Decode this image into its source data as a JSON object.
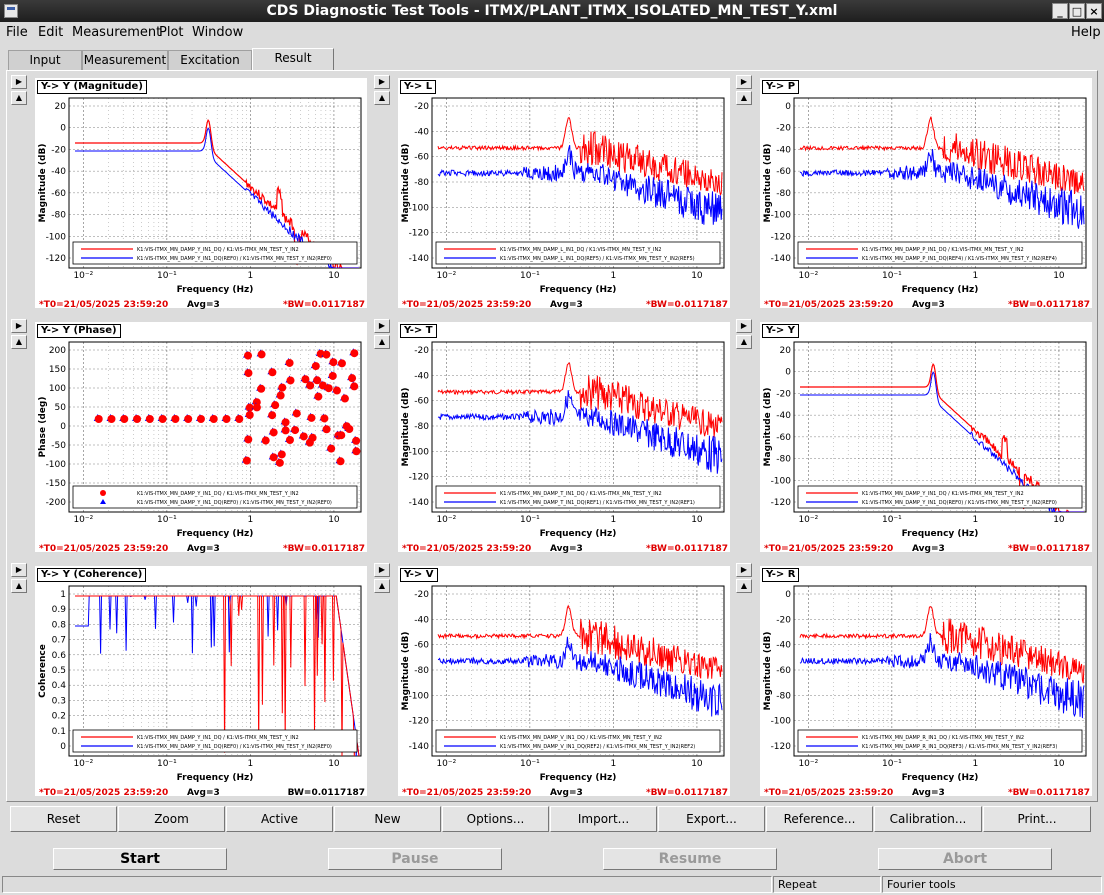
{
  "window": {
    "title": "CDS Diagnostic Test Tools - ITMX/PLANT_ITMX_ISOLATED_MN_TEST_Y.xml",
    "controls": [
      "_",
      "□",
      "×"
    ]
  },
  "menu": {
    "file": "File",
    "edit": "Edit",
    "measurement": "Measurement",
    "plot": "Plot",
    "window": "Window",
    "help": "Help"
  },
  "tabs": [
    "Input",
    "Measurement",
    "Excitation",
    "Result"
  ],
  "colors": {
    "red": "#ff0000",
    "blue": "#0000ff"
  },
  "panels": [
    {
      "title": "Y-> Y (Magnitude)",
      "ylabel": "Magnitude (dB)",
      "xlabel": "Frequency (Hz)",
      "yticks": [
        "20",
        "0",
        "-20",
        "-40",
        "-60",
        "-80",
        "-100",
        "-120"
      ],
      "xticks": [
        "10⁻²",
        "10⁻¹",
        "1",
        "10"
      ],
      "legend": [
        "K1:VIS-ITMX_MN_DAMP_Y_IN1_DQ / K1:VIS-ITMX_MN_TEST_Y_IN2",
        "K1:VIS-ITMX_MN_DAMP_Y_IN1_DQ(REF0) / K1:VIS-ITMX_MN_TEST_Y_IN2(REF0)"
      ],
      "t0": "*T0=21/05/2025 23:59:20",
      "avg": "Avg=3",
      "bw": "*BW=0.0117187",
      "kind": "mag"
    },
    {
      "title": "Y-> L",
      "ylabel": "Magnitude (dB)",
      "xlabel": "Frequency (Hz)",
      "yticks": [
        "-20",
        "-40",
        "-60",
        "-80",
        "-100",
        "-120",
        "-140"
      ],
      "xticks": [
        "10⁻²",
        "10⁻¹",
        "1",
        "10"
      ],
      "legend": [
        "K1:VIS-ITMX_MN_DAMP_L_IN1_DQ / K1:VIS-ITMX_MN_TEST_Y_IN2",
        "K1:VIS-ITMX_MN_DAMP_L_IN1_DQ(REF5) / K1:VIS-ITMX_MN_TEST_Y_IN2(REF5)"
      ],
      "t0": "*T0=21/05/2025 23:59:20",
      "avg": "Avg=3",
      "bw": "*BW=0.0117187",
      "kind": "cross"
    },
    {
      "title": "Y-> P",
      "ylabel": "Magnitude (dB)",
      "xlabel": "Frequency (Hz)",
      "yticks": [
        "0",
        "-20",
        "-40",
        "-60",
        "-80",
        "-100",
        "-120",
        "-140"
      ],
      "xticks": [
        "10⁻²",
        "10⁻¹",
        "1",
        "10"
      ],
      "legend": [
        "K1:VIS-ITMX_MN_DAMP_P_IN1_DQ / K1:VIS-ITMX_MN_TEST_Y_IN2",
        "K1:VIS-ITMX_MN_DAMP_P_IN1_DQ(REF4) / K1:VIS-ITMX_MN_TEST_Y_IN2(REF4)"
      ],
      "t0": "*T0=21/05/2025 23:59:20",
      "avg": "Avg=3",
      "bw": "*BW=0.0117187",
      "kind": "cross"
    },
    {
      "title": "Y-> Y (Phase)",
      "ylabel": "Phase (deg)",
      "xlabel": "Frequency (Hz)",
      "yticks": [
        "200",
        "150",
        "100",
        "50",
        "0",
        "-50",
        "-100",
        "-150",
        "-200"
      ],
      "xticks": [
        "10⁻²",
        "10⁻¹",
        "1",
        "10"
      ],
      "legend": [
        "K1:VIS-ITMX_MN_DAMP_Y_IN1_DQ / K1:VIS-ITMX_MN_TEST_Y_IN2",
        "K1:VIS-ITMX_MN_DAMP_Y_IN1_DQ(REF0) / K1:VIS-ITMX_MN_TEST_Y_IN2(REF0)"
      ],
      "t0": "*T0=21/05/2025 23:59:20",
      "avg": "Avg=3",
      "bw": "*BW=0.0117187",
      "kind": "phase"
    },
    {
      "title": "Y-> T",
      "ylabel": "Magnitude (dB)",
      "xlabel": "Frequency (Hz)",
      "yticks": [
        "-20",
        "-40",
        "-60",
        "-80",
        "-100",
        "-120",
        "-140"
      ],
      "xticks": [
        "10⁻²",
        "10⁻¹",
        "1",
        "10"
      ],
      "legend": [
        "K1:VIS-ITMX_MN_DAMP_T_IN1_DQ / K1:VIS-ITMX_MN_TEST_Y_IN2",
        "K1:VIS-ITMX_MN_DAMP_T_IN1_DQ(REF1) / K1:VIS-ITMX_MN_TEST_Y_IN2(REF1)"
      ],
      "t0": "*T0=21/05/2025 23:59:20",
      "avg": "Avg=3",
      "bw": "*BW=0.0117187",
      "kind": "cross"
    },
    {
      "title": "Y-> Y",
      "ylabel": "Magnitude (dB)",
      "xlabel": "Frequency (Hz)",
      "yticks": [
        "20",
        "0",
        "-20",
        "-40",
        "-60",
        "-80",
        "-100",
        "-120"
      ],
      "xticks": [
        "10⁻²",
        "10⁻¹",
        "1",
        "10"
      ],
      "legend": [
        "K1:VIS-ITMX_MN_DAMP_Y_IN1_DQ / K1:VIS-ITMX_MN_TEST_Y_IN2",
        "K1:VIS-ITMX_MN_DAMP_Y_IN1_DQ(REF0) / K1:VIS-ITMX_MN_TEST_Y_IN2(REF0)"
      ],
      "t0": "*T0=21/05/2025 23:59:20",
      "avg": "Avg=3",
      "bw": "*BW=0.0117187",
      "kind": "mag"
    },
    {
      "title": "Y-> Y (Coherence)",
      "ylabel": "Coherence",
      "xlabel": "Frequency (Hz)",
      "yticks": [
        "1",
        "0.9",
        "0.8",
        "0.7",
        "0.6",
        "0.5",
        "0.4",
        "0.3",
        "0.2",
        "0.1",
        "0"
      ],
      "xticks": [
        "10⁻²",
        "10⁻¹",
        "1",
        "10"
      ],
      "legend": [
        "K1:VIS-ITMX_MN_DAMP_Y_IN1_DQ / K1:VIS-ITMX_MN_TEST_Y_IN2",
        "K1:VIS-ITMX_MN_DAMP_Y_IN1_DQ(REF0) / K1:VIS-ITMX_MN_TEST_Y_IN2(REF0)"
      ],
      "t0": "*T0=21/05/2025 23:59:20",
      "avg": "Avg=3",
      "bw": "BW=0.0117187",
      "kind": "coh"
    },
    {
      "title": "Y-> V",
      "ylabel": "Magnitude (dB)",
      "xlabel": "Frequency (Hz)",
      "yticks": [
        "-20",
        "-40",
        "-60",
        "-80",
        "-100",
        "-120",
        "-140"
      ],
      "xticks": [
        "10⁻²",
        "10⁻¹",
        "1",
        "10"
      ],
      "legend": [
        "K1:VIS-ITMX_MN_DAMP_V_IN1_DQ / K1:VIS-ITMX_MN_TEST_Y_IN2",
        "K1:VIS-ITMX_MN_DAMP_V_IN1_DQ(REF2) / K1:VIS-ITMX_MN_TEST_Y_IN2(REF2)"
      ],
      "t0": "*T0=21/05/2025 23:59:20",
      "avg": "Avg=3",
      "bw": "*BW=0.0117187",
      "kind": "cross"
    },
    {
      "title": "Y-> R",
      "ylabel": "Magnitude (dB)",
      "xlabel": "Frequency (Hz)",
      "yticks": [
        "0",
        "-20",
        "-40",
        "-60",
        "-80",
        "-100",
        "-120"
      ],
      "xticks": [
        "10⁻²",
        "10⁻¹",
        "1",
        "10"
      ],
      "legend": [
        "K1:VIS-ITMX_MN_DAMP_R_IN1_DQ / K1:VIS-ITMX_MN_TEST_Y_IN2",
        "K1:VIS-ITMX_MN_DAMP_R_IN1_DQ(REF3) / K1:VIS-ITMX_MN_TEST_Y_IN2(REF3)"
      ],
      "t0": "*T0=21/05/2025 23:59:20",
      "avg": "Avg=3",
      "bw": "*BW=0.0117187",
      "kind": "cross"
    }
  ],
  "buttons": [
    "Reset",
    "Zoom",
    "Active",
    "New",
    "Options...",
    "Import...",
    "Export...",
    "Reference...",
    "Calibration...",
    "Print..."
  ],
  "run": {
    "start": "Start",
    "pause": "Pause",
    "resume": "Resume",
    "abort": "Abort"
  },
  "status": {
    "repeat": "Repeat",
    "fourier": "Fourier tools"
  }
}
